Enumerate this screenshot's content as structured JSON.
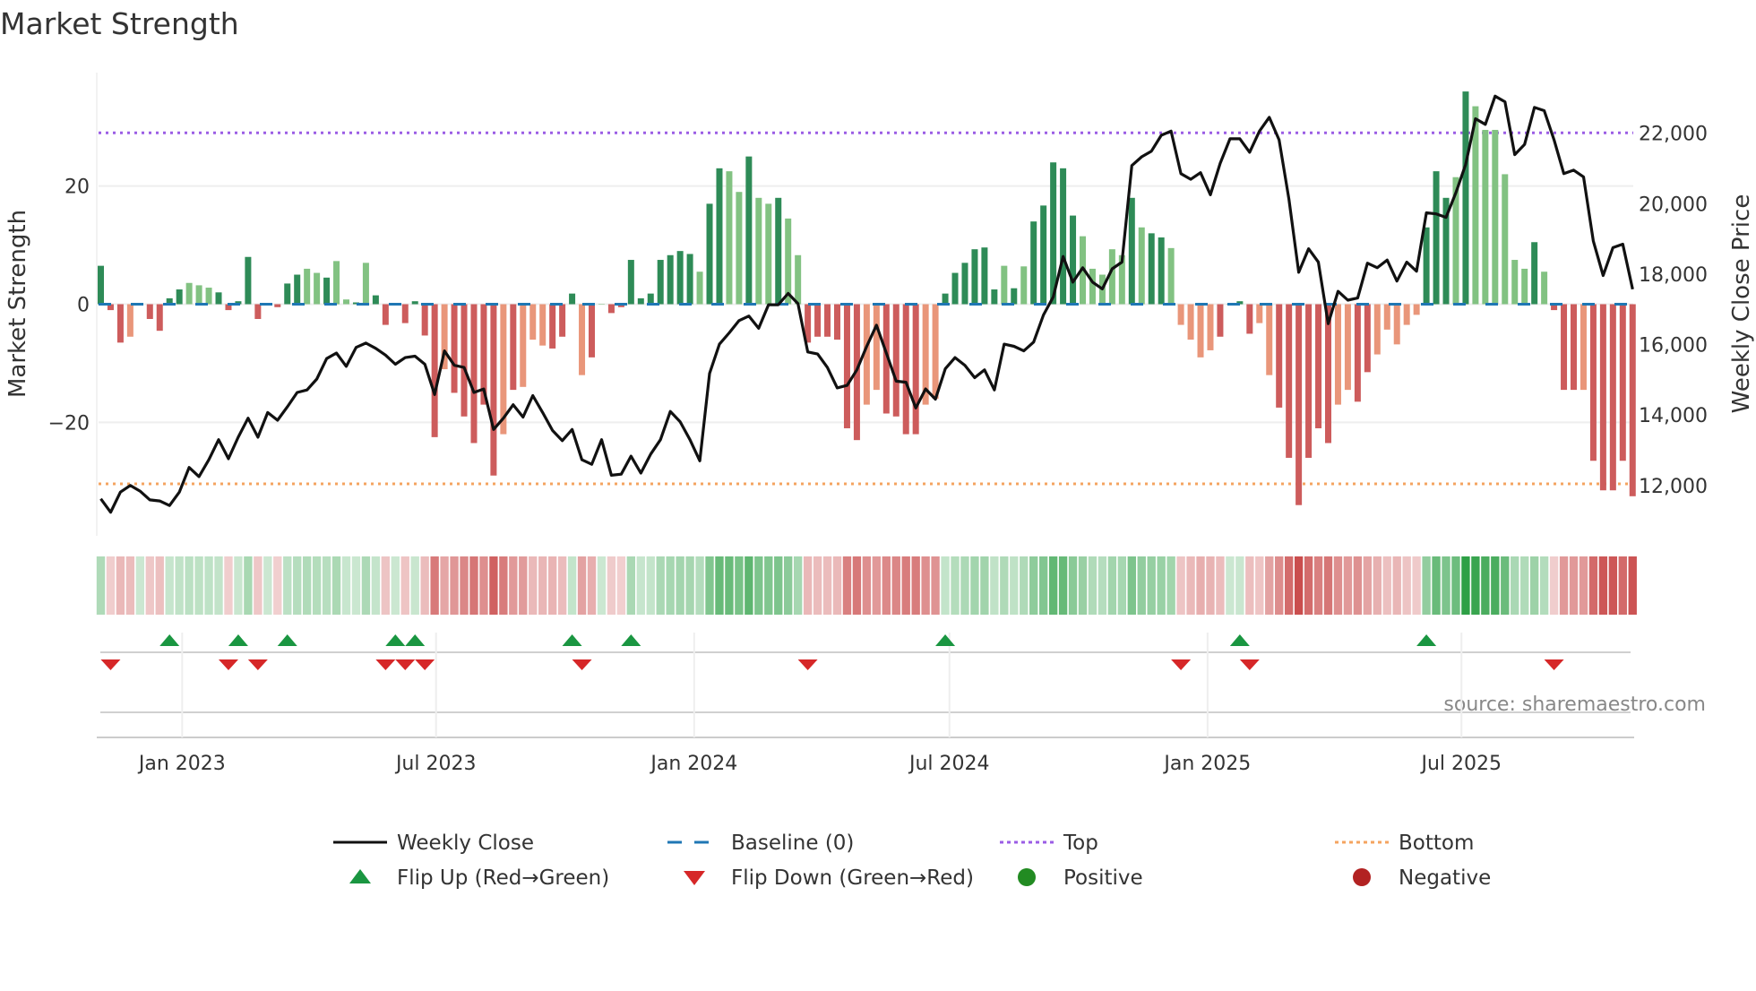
{
  "chart_data": {
    "type": "bar",
    "title": "Market Strength",
    "ylabel": "Market Strength",
    "y2label": "Weekly Close Price",
    "ylim": [
      -39.2,
      39.2
    ],
    "y2lim": [
      10570,
      23720
    ],
    "yticks": [
      {
        "v": 20,
        "label": "20"
      },
      {
        "v": 0,
        "label": "0"
      },
      {
        "v": -20,
        "label": "−20"
      }
    ],
    "y2ticks": [
      {
        "v": 12000,
        "label": "12,000"
      },
      {
        "v": 14000,
        "label": "14,000"
      },
      {
        "v": 16000,
        "label": "16,000"
      },
      {
        "v": 18000,
        "label": "18,000"
      },
      {
        "v": 20000,
        "label": "20,000"
      },
      {
        "v": 22000,
        "label": "22,000"
      }
    ],
    "xticks": [
      {
        "date": "2023-01-01",
        "label": "Jan 2023"
      },
      {
        "date": "2023-07-01",
        "label": "Jul 2023"
      },
      {
        "date": "2024-01-01",
        "label": "Jan 2024"
      },
      {
        "date": "2024-07-01",
        "label": "Jul 2024"
      },
      {
        "date": "2025-01-01",
        "label": "Jan 2025"
      },
      {
        "date": "2025-07-01",
        "label": "Jul 2025"
      }
    ],
    "x_start": "2022-11-04",
    "frequency": "weekly",
    "top_level": 29.0,
    "bottom_level": -30.4,
    "strength": [
      6.5,
      -1,
      -6.5,
      -5.5,
      0,
      -2.5,
      -4.5,
      1,
      2.5,
      3.6,
      3.2,
      2.8,
      2,
      -1,
      0.5,
      8,
      -2.5,
      0,
      -0.5,
      3.5,
      5,
      6,
      5.3,
      4.5,
      7.3,
      0.8,
      0.3,
      7,
      1.5,
      -3.5,
      0,
      -3.2,
      0.5,
      -5.3,
      -22.5,
      -11,
      -15,
      -19,
      -23.5,
      -17,
      -29,
      -22,
      -14.5,
      -14,
      -6,
      -7,
      -7.5,
      -5.5,
      1.8,
      -12,
      -9,
      0,
      -1.5,
      -0.5,
      7.5,
      1,
      1.8,
      7.5,
      8.3,
      9,
      8.5,
      5.5,
      17,
      23,
      22.5,
      19,
      25,
      18,
      17,
      18,
      14.5,
      8.3,
      -6.5,
      -5.5,
      -5.5,
      -6,
      -21,
      -23,
      -17,
      -14.5,
      -18.5,
      -19,
      -22,
      -22,
      -17,
      -16,
      1.8,
      5.3,
      7,
      9.3,
      9.6,
      2.5,
      6.5,
      2.7,
      6.4,
      14,
      16.7,
      24,
      23,
      15,
      11.5,
      6,
      5,
      9.3,
      8.3,
      18,
      13,
      12,
      11.3,
      9.5,
      -3.5,
      -6,
      -9,
      -7.8,
      -5.5,
      0,
      0.5,
      -5,
      -3.2,
      -12,
      -17.5,
      -26,
      -34,
      -26,
      -21,
      -23.5,
      -17,
      -14.5,
      -16.5,
      -11.5,
      -8.5,
      -4.3,
      -6.8,
      -3.5,
      -1.8,
      13,
      22.5,
      18,
      21.5,
      36,
      33.5,
      29.5,
      29.5,
      22,
      7.5,
      6,
      10.5,
      5.5,
      -1,
      -14.5,
      -14.5,
      -14.5,
      -26.5,
      -31.5,
      -31.5,
      -26.5,
      -32.5
    ],
    "shade": "dddldddddllldddddddddlldlldldddddddldddddldllldddldldddddddddlddlldlldllddddddllddddllddddddldldddddllllldlddlllllddddllddddddllddllllldddldlllllldldddldddddll",
    "weekly_close": [
      11620,
      11240,
      11810,
      12000,
      11840,
      11590,
      11560,
      11430,
      11810,
      12510,
      12250,
      12730,
      13300,
      12760,
      13370,
      13910,
      13370,
      14070,
      13850,
      14230,
      14640,
      14710,
      15020,
      15600,
      15760,
      15380,
      15920,
      16040,
      15890,
      15700,
      15440,
      15630,
      15670,
      15440,
      14580,
      15820,
      15410,
      15350,
      14640,
      14740,
      13590,
      13910,
      14290,
      13940,
      14550,
      14070,
      13560,
      13270,
      13590,
      12730,
      12600,
      13300,
      12290,
      12320,
      12830,
      12350,
      12890,
      13300,
      14100,
      13810,
      13300,
      12700,
      15180,
      16010,
      16330,
      16680,
      16810,
      16460,
      17130,
      17130,
      17450,
      17160,
      15790,
      15730,
      15350,
      14770,
      14840,
      15280,
      15950,
      16550,
      15760,
      14960,
      14930,
      14200,
      14740,
      14450,
      15310,
      15630,
      15410,
      15060,
      15280,
      14710,
      16010,
      15950,
      15820,
      16070,
      16840,
      17350,
      18500,
      17770,
      18180,
      17770,
      17580,
      18150,
      18340,
      21080,
      21330,
      21490,
      21940,
      22060,
      20850,
      20690,
      20880,
      20250,
      21140,
      21840,
      21840,
      21460,
      22060,
      22450,
      21810,
      20120,
      18050,
      18720,
      18340,
      16590,
      17510,
      17260,
      17320,
      18310,
      18180,
      18400,
      17800,
      18340,
      18080,
      19740,
      19710,
      19610,
      20310,
      21110,
      22410,
      22250,
      23050,
      22890,
      21390,
      21680,
      22730,
      22640,
      21810,
      20850,
      20950,
      20760,
      18940,
      17960,
      18750,
      18850,
      17570
    ],
    "flip_up_index": [
      7,
      14,
      19,
      30,
      32,
      48,
      54,
      86,
      116,
      135
    ],
    "flip_down_index": [
      1,
      13,
      16,
      29,
      31,
      33,
      49,
      72,
      110,
      117,
      148
    ],
    "legend": [
      {
        "key": "close",
        "label": "Weekly Close"
      },
      {
        "key": "baseline",
        "label": "Baseline (0)"
      },
      {
        "key": "top",
        "label": "Top"
      },
      {
        "key": "bottom",
        "label": "Bottom"
      },
      {
        "key": "up",
        "label": "Flip Up (Red→Green)"
      },
      {
        "key": "down",
        "label": "Flip Down (Green→Red)"
      },
      {
        "key": "pos",
        "label": "Positive"
      },
      {
        "key": "neg",
        "label": "Negative"
      }
    ],
    "source": "source: sharemaestro.com",
    "colors": {
      "pos_dark": "#2e8b57",
      "pos_light": "#82c282",
      "neg_dark": "#cd5c5c",
      "neg_light": "#e9967a",
      "top": "#9b5de5",
      "bottom": "#f4a460",
      "baseline": "#1f77b4",
      "up": "#1a9641",
      "down": "#d62728",
      "pos_dot": "#228b22",
      "neg_dot": "#b22222"
    }
  }
}
